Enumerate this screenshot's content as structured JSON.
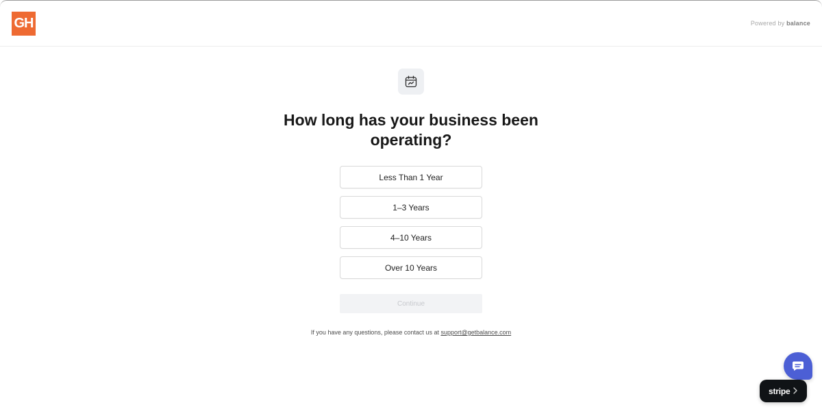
{
  "header": {
    "logo_text": "GH",
    "powered_prefix": "Powered by",
    "powered_brand": "balance"
  },
  "main": {
    "icon": "calendar-chart-icon",
    "question": "How long has your business been operating?",
    "options": [
      {
        "label": "Less Than 1 Year"
      },
      {
        "label": "1–3 Years"
      },
      {
        "label": "4–10 Years"
      },
      {
        "label": "Over 10 Years"
      }
    ],
    "continue_label": "Continue",
    "contact_prefix": "If you have any questions, please contact us at",
    "contact_email": "support@getbalance.com"
  },
  "widgets": {
    "chat_icon": "chat-bubble-icon",
    "stripe_label": "stripe",
    "stripe_chevron": "chevron-right-icon"
  },
  "colors": {
    "logo_bg": "#ee6a32",
    "chat_bg": "#4c5fd5",
    "stripe_bg": "#101316",
    "continue_disabled_bg": "#f2f3f5"
  }
}
